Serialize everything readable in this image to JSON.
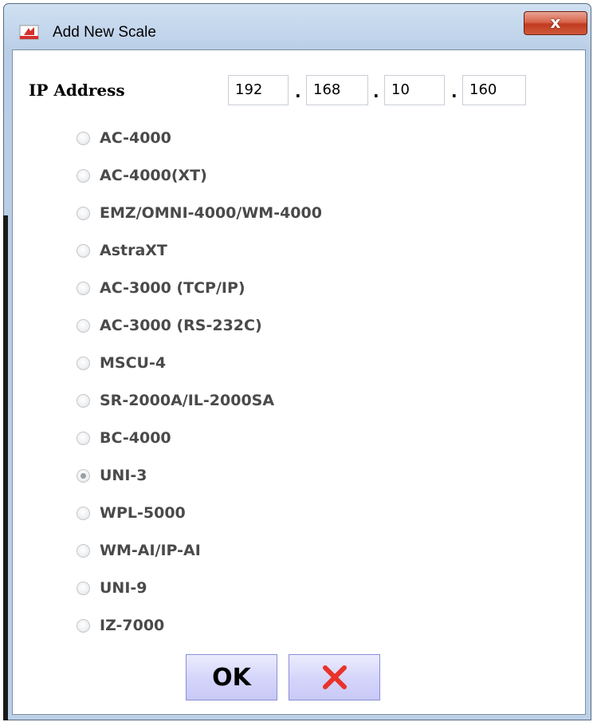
{
  "window": {
    "title": "Add New Scale",
    "close_glyph": "x"
  },
  "ip": {
    "label": "IP Address",
    "octets": [
      "192",
      "168",
      "10",
      "160"
    ],
    "separator": "."
  },
  "scales": {
    "selected": "UNI-3",
    "options": [
      {
        "label": "AC-4000",
        "selected": false
      },
      {
        "label": "AC-4000(XT)",
        "selected": false
      },
      {
        "label": "EMZ/OMNI-4000/WM-4000",
        "selected": false
      },
      {
        "label": "AstraXT",
        "selected": false
      },
      {
        "label": "AC-3000 (TCP/IP)",
        "selected": false
      },
      {
        "label": "AC-3000 (RS-232C)",
        "selected": false
      },
      {
        "label": "MSCU-4",
        "selected": false
      },
      {
        "label": "SR-2000A/IL-2000SA",
        "selected": false
      },
      {
        "label": "BC-4000",
        "selected": false
      },
      {
        "label": "UNI-3",
        "selected": true
      },
      {
        "label": "WPL-5000",
        "selected": false
      },
      {
        "label": "WM-AI/IP-AI",
        "selected": false
      },
      {
        "label": "UNI-9",
        "selected": false
      },
      {
        "label": "IZ-7000",
        "selected": false
      }
    ]
  },
  "buttons": {
    "ok_label": "OK",
    "cancel_icon": "red-x-icon"
  },
  "colors": {
    "cancel_x": "#e8322a",
    "button_fill": "#d4d4fb",
    "close_button": "#c8472b"
  }
}
